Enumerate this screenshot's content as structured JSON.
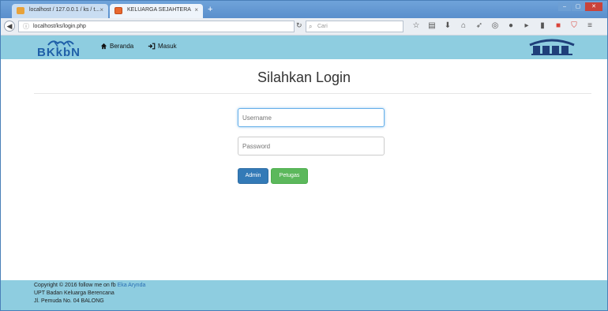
{
  "browser": {
    "tabs": [
      {
        "label": "localhost / 127.0.0.1 / ks / t..."
      },
      {
        "label": "KELUARGA SEJAHTERA"
      }
    ],
    "tab_close": "×",
    "new_tab": "+",
    "url": "localhost/ks/login.php",
    "search_placeholder": "Cari"
  },
  "site": {
    "logo_text": "BKkbN",
    "nav": [
      {
        "label": "Beranda",
        "icon": "home-icon"
      },
      {
        "label": "Masuk",
        "icon": "sign-in-icon"
      }
    ]
  },
  "login": {
    "title": "Silahkan Login",
    "username_placeholder": "Username",
    "password_placeholder": "Password",
    "admin_label": "Admin",
    "petugas_label": "Petugas"
  },
  "footer": {
    "copyright_prefix": "Copyright © 2016 follow me on fb",
    "copyright_link": "Eka Arynda",
    "line2": "UPT Badan Keluarga Berencana",
    "line3": "Jl. Pemuda No. 04 BALONG"
  },
  "colors": {
    "header_bg": "#8ecde0",
    "primary": "#337ab7",
    "success": "#5cb85c"
  }
}
